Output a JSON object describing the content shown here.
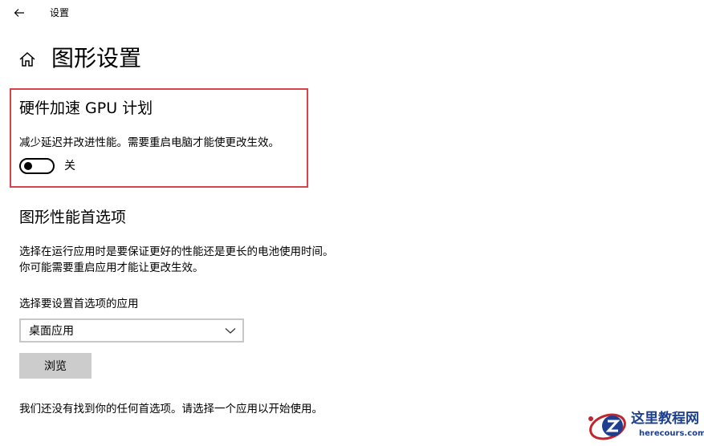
{
  "window": {
    "title": "设置"
  },
  "header": {
    "page_title": "图形设置"
  },
  "hardware_gpu": {
    "title": "硬件加速 GPU 计划",
    "description": "减少延迟并改进性能。需要重启电脑才能使更改生效。",
    "toggle_state": "关",
    "toggle_on": false
  },
  "performance": {
    "title": "图形性能首选项",
    "description_line1": "选择在运行应用时是要保证更好的性能还是更长的电池使用时间。",
    "description_line2": "你可能需要重启应用才能让更改生效。",
    "select_label": "选择要设置首选项的应用",
    "select_value": "桌面应用",
    "browse_label": "浏览",
    "empty_note": "我们还没有找到你的任何首选项。请选择一个应用以开始使用。"
  },
  "watermark": {
    "title": "这里教程网",
    "url": "herecours.com"
  },
  "colors": {
    "highlight_border": "#d9434b",
    "button_bg": "#cccccc",
    "watermark_blue": "#1d3f8e",
    "watermark_red": "#c0262d"
  },
  "icons": {
    "back": "back-arrow-icon",
    "home": "home-icon",
    "dropdown": "chevron-down-icon",
    "logo": "watermark-logo-icon"
  }
}
